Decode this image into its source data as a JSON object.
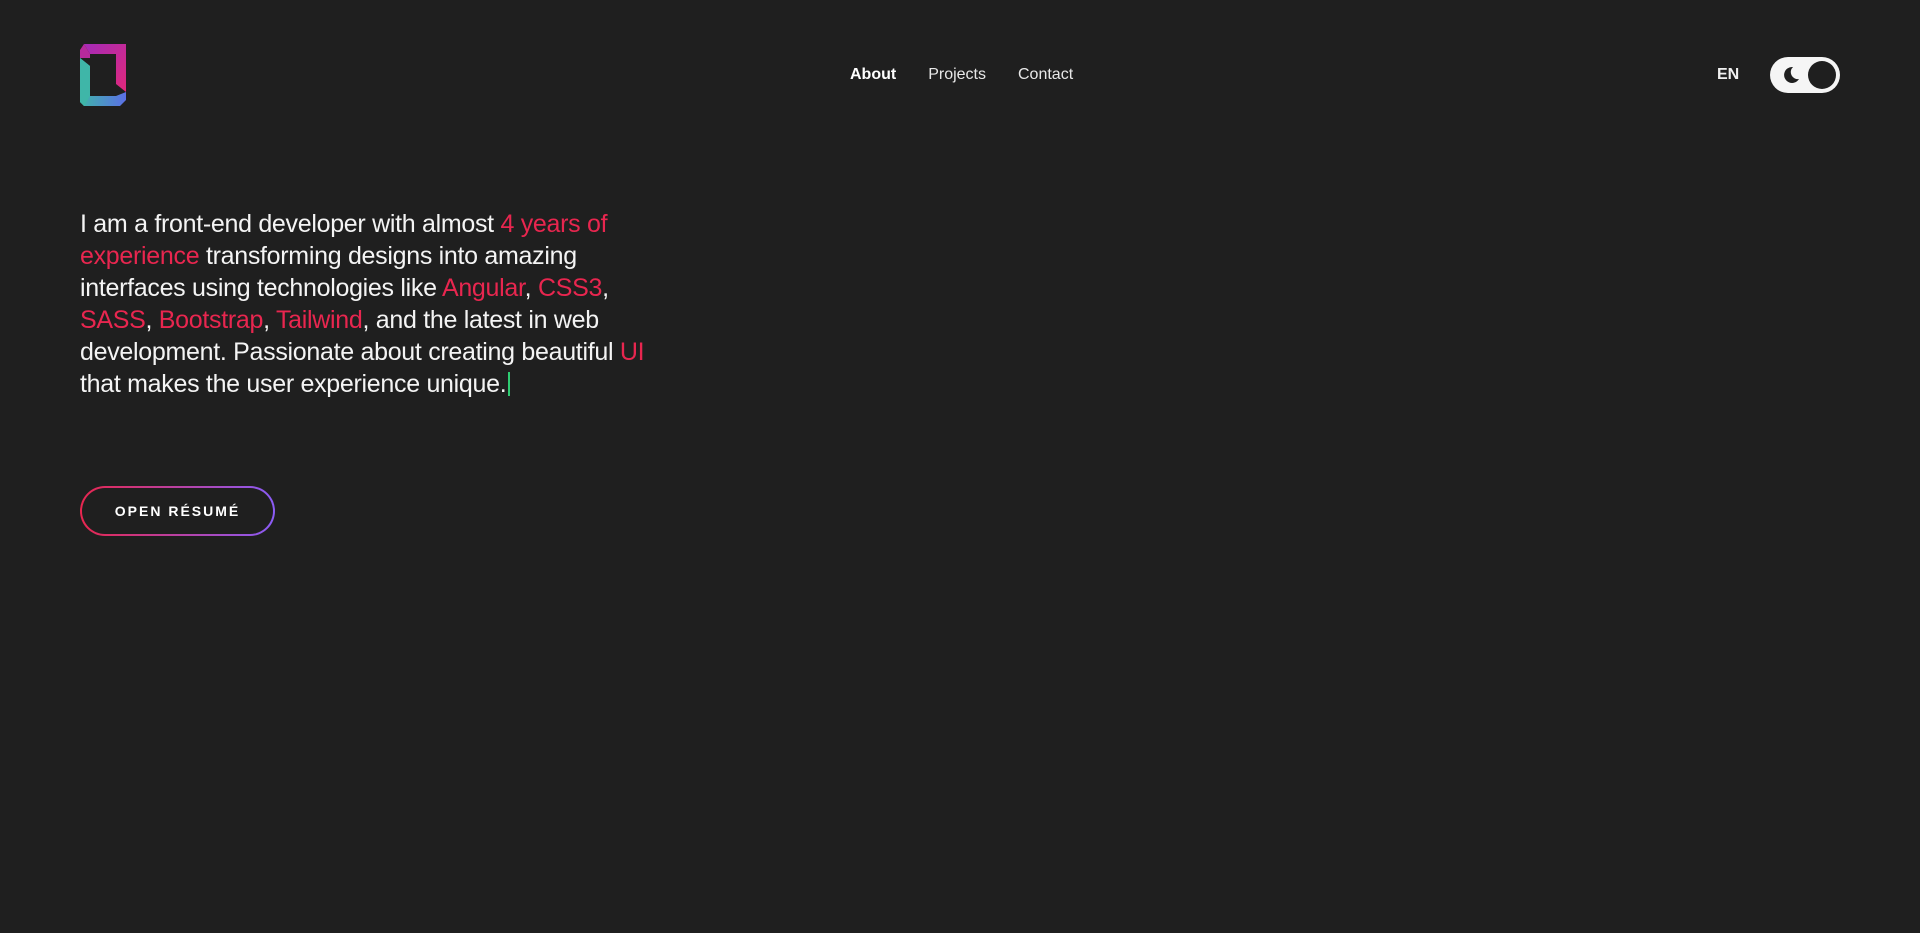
{
  "header": {
    "logo_icon": "gradient-bracket-logo-icon",
    "nav": [
      {
        "label": "About",
        "active": true
      },
      {
        "label": "Projects",
        "active": false
      },
      {
        "label": "Contact",
        "active": false
      }
    ],
    "language": "EN",
    "theme_toggle": {
      "icon": "moon-icon",
      "state": "dark"
    }
  },
  "intro": {
    "t1": "I am a front-end developer with almost ",
    "h1": "4 years of experience",
    "t2": " transforming designs into amazing interfaces using technologies like ",
    "h2": "Angular",
    "t3": ", ",
    "h3": "CSS3",
    "t4": ", ",
    "h4": "SASS",
    "t5": ", ",
    "h5": "Bootstrap",
    "t6": ", ",
    "h6": "Tailwind",
    "t7": ", and the latest in web development. Passionate about creating beautiful ",
    "h7": "UI",
    "t8": " that makes the user experience unique."
  },
  "resume_button": {
    "label": "OPEN RÉSUMÉ"
  },
  "colors": {
    "background": "#1f1f1f",
    "accent": "#e8264f",
    "gradient_end": "#8a5cf6",
    "caret": "#2ecc71",
    "logo_magenta": "#c81f8f",
    "logo_teal": "#3fb6a8",
    "logo_blue": "#4f7fe0"
  }
}
